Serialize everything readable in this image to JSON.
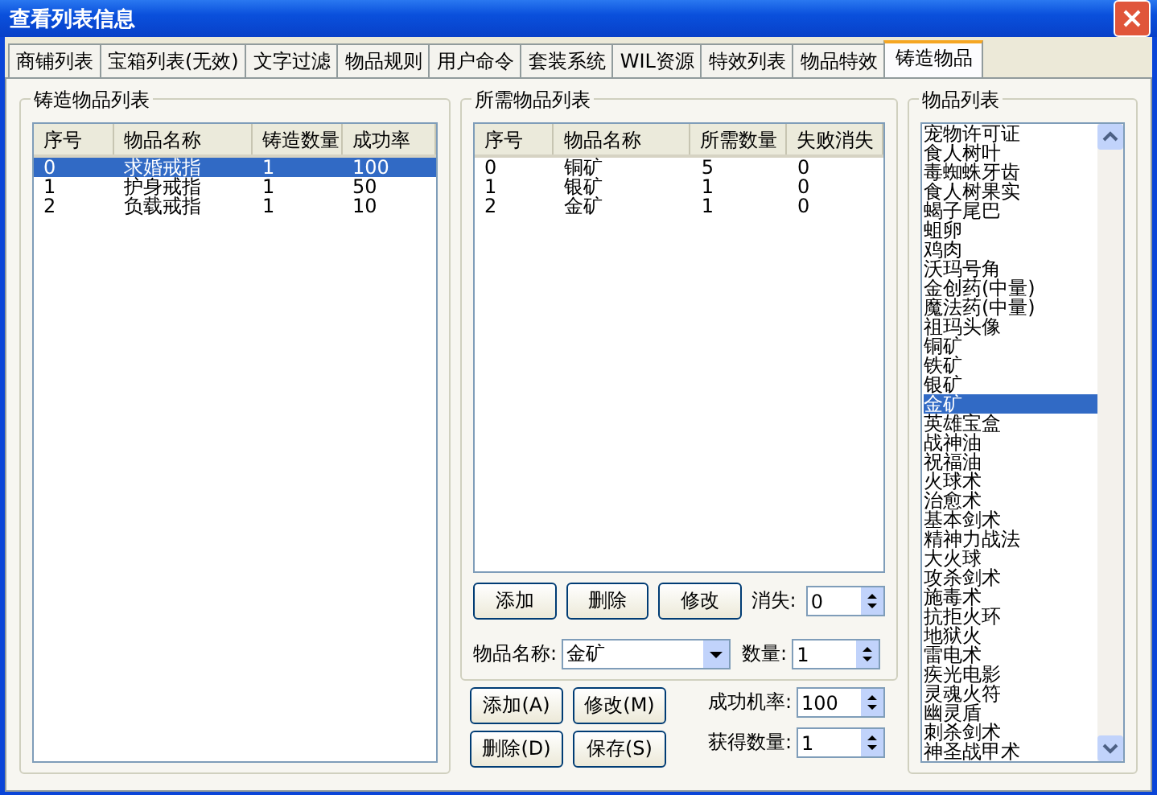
{
  "window": {
    "title": "查看列表信息"
  },
  "tabs": [
    {
      "label": "商铺列表",
      "selected": false
    },
    {
      "label": "宝箱列表(无效)",
      "selected": false
    },
    {
      "label": "文字过滤",
      "selected": false
    },
    {
      "label": "物品规则",
      "selected": false
    },
    {
      "label": "用户命令",
      "selected": false
    },
    {
      "label": "套装系统",
      "selected": false
    },
    {
      "label": "WIL资源",
      "selected": false
    },
    {
      "label": "特效列表",
      "selected": false
    },
    {
      "label": "物品特效",
      "selected": false
    },
    {
      "label": "铸造物品",
      "selected": true
    }
  ],
  "forge_panel": {
    "title": "铸造物品列表",
    "columns": [
      "序号",
      "物品名称",
      "铸造数量",
      "成功率"
    ],
    "rows": [
      {
        "cells": [
          "0",
          "求婚戒指",
          "1",
          "100"
        ],
        "selected": true
      },
      {
        "cells": [
          "1",
          "护身戒指",
          "1",
          "50"
        ],
        "selected": false
      },
      {
        "cells": [
          "2",
          "负载戒指",
          "1",
          "10"
        ],
        "selected": false
      }
    ]
  },
  "required_panel": {
    "title": "所需物品列表",
    "columns": [
      "序号",
      "物品名称",
      "所需数量",
      "失败消失"
    ],
    "rows": [
      {
        "cells": [
          "0",
          "铜矿",
          "5",
          "0"
        ],
        "selected": false
      },
      {
        "cells": [
          "1",
          "银矿",
          "1",
          "0"
        ],
        "selected": false
      },
      {
        "cells": [
          "2",
          "金矿",
          "1",
          "0"
        ],
        "selected": false
      }
    ],
    "buttons": [
      "添加",
      "删除",
      "修改"
    ],
    "vanish": {
      "label": "消失:",
      "value": "0"
    },
    "item_name": {
      "label": "物品名称:",
      "value": "金矿"
    },
    "quantity": {
      "label": "数量:",
      "value": "1"
    }
  },
  "action_buttons": [
    "添加(A)",
    "修改(M)",
    "删除(D)",
    "保存(S)"
  ],
  "success_rate": {
    "label": "成功机率:",
    "value": "100"
  },
  "obtain_quantity": {
    "label": "获得数量:",
    "value": "1"
  },
  "item_list": {
    "title": "物品列表",
    "items": [
      {
        "label": "宠物许可证",
        "selected": false
      },
      {
        "label": "食人树叶",
        "selected": false
      },
      {
        "label": "毒蜘蛛牙齿",
        "selected": false
      },
      {
        "label": "食人树果实",
        "selected": false
      },
      {
        "label": "蝎子尾巴",
        "selected": false
      },
      {
        "label": "蛆卵",
        "selected": false
      },
      {
        "label": "鸡肉",
        "selected": false
      },
      {
        "label": "沃玛号角",
        "selected": false
      },
      {
        "label": "金创药(中量)",
        "selected": false
      },
      {
        "label": "魔法药(中量)",
        "selected": false
      },
      {
        "label": "祖玛头像",
        "selected": false
      },
      {
        "label": "铜矿",
        "selected": false
      },
      {
        "label": "铁矿",
        "selected": false
      },
      {
        "label": "银矿",
        "selected": false
      },
      {
        "label": "金矿",
        "selected": true
      },
      {
        "label": "英雄宝盒",
        "selected": false
      },
      {
        "label": "战神油",
        "selected": false
      },
      {
        "label": "祝福油",
        "selected": false
      },
      {
        "label": "火球术",
        "selected": false
      },
      {
        "label": "治愈术",
        "selected": false
      },
      {
        "label": "基本剑术",
        "selected": false
      },
      {
        "label": "精神力战法",
        "selected": false
      },
      {
        "label": "大火球",
        "selected": false
      },
      {
        "label": "攻杀剑术",
        "selected": false
      },
      {
        "label": "施毒术",
        "selected": false
      },
      {
        "label": "抗拒火环",
        "selected": false
      },
      {
        "label": "地狱火",
        "selected": false
      },
      {
        "label": "雷电术",
        "selected": false
      },
      {
        "label": "疾光电影",
        "selected": false
      },
      {
        "label": "灵魂火符",
        "selected": false
      },
      {
        "label": "幽灵盾",
        "selected": false
      },
      {
        "label": "刺杀剑术",
        "selected": false
      },
      {
        "label": "神圣战甲术",
        "selected": false
      }
    ]
  }
}
